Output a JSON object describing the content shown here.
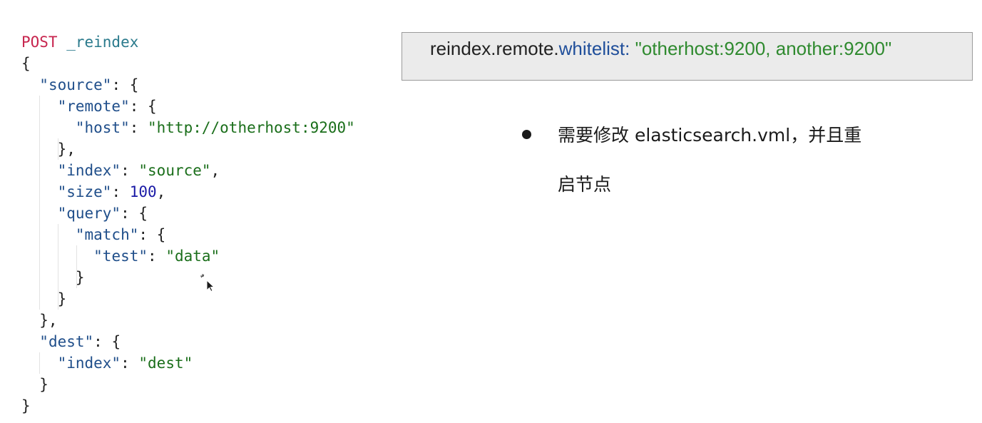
{
  "code": {
    "lines": [
      [
        [
          "POST",
          "method"
        ],
        [
          " _reindex",
          "path"
        ]
      ],
      [
        [
          "{",
          "punc"
        ]
      ],
      [
        [
          "  ",
          "punc"
        ],
        [
          "\"source\"",
          "key"
        ],
        [
          ": {",
          "punc"
        ]
      ],
      [
        [
          "    ",
          "punc"
        ],
        [
          "\"remote\"",
          "key"
        ],
        [
          ": {",
          "punc"
        ]
      ],
      [
        [
          "      ",
          "punc"
        ],
        [
          "\"host\"",
          "key"
        ],
        [
          ": ",
          "punc"
        ],
        [
          "\"http://otherhost:9200\"",
          "str"
        ]
      ],
      [
        [
          "    },",
          "punc"
        ]
      ],
      [
        [
          "    ",
          "punc"
        ],
        [
          "\"index\"",
          "key"
        ],
        [
          ": ",
          "punc"
        ],
        [
          "\"source\"",
          "str"
        ],
        [
          ",",
          "punc"
        ]
      ],
      [
        [
          "    ",
          "punc"
        ],
        [
          "\"size\"",
          "key"
        ],
        [
          ": ",
          "punc"
        ],
        [
          "100",
          "num"
        ],
        [
          ",",
          "punc"
        ]
      ],
      [
        [
          "    ",
          "punc"
        ],
        [
          "\"query\"",
          "key"
        ],
        [
          ": {",
          "punc"
        ]
      ],
      [
        [
          "      ",
          "punc"
        ],
        [
          "\"match\"",
          "key"
        ],
        [
          ": {",
          "punc"
        ]
      ],
      [
        [
          "        ",
          "punc"
        ],
        [
          "\"test\"",
          "key"
        ],
        [
          ": ",
          "punc"
        ],
        [
          "\"data\"",
          "str"
        ]
      ],
      [
        [
          "      }",
          "punc"
        ]
      ],
      [
        [
          "    }",
          "punc"
        ]
      ],
      [
        [
          "  },",
          "punc"
        ]
      ],
      [
        [
          "  ",
          "punc"
        ],
        [
          "\"dest\"",
          "key"
        ],
        [
          ": {",
          "punc"
        ]
      ],
      [
        [
          "    ",
          "punc"
        ],
        [
          "\"index\"",
          "key"
        ],
        [
          ": ",
          "punc"
        ],
        [
          "\"dest\"",
          "str"
        ]
      ],
      [
        [
          "  }",
          "punc"
        ]
      ],
      [
        [
          "}",
          "punc"
        ]
      ]
    ]
  },
  "config": {
    "key_part1": "reindex.remote.",
    "key_part2": "whitelist:",
    "value": " \"otherhost:9200, another:9200\""
  },
  "note": {
    "line1": "需要修改 elasticsearch.vml，并且重",
    "line2": "启节点"
  },
  "cursor": {
    "icon": "mouse-pointer-icon"
  }
}
